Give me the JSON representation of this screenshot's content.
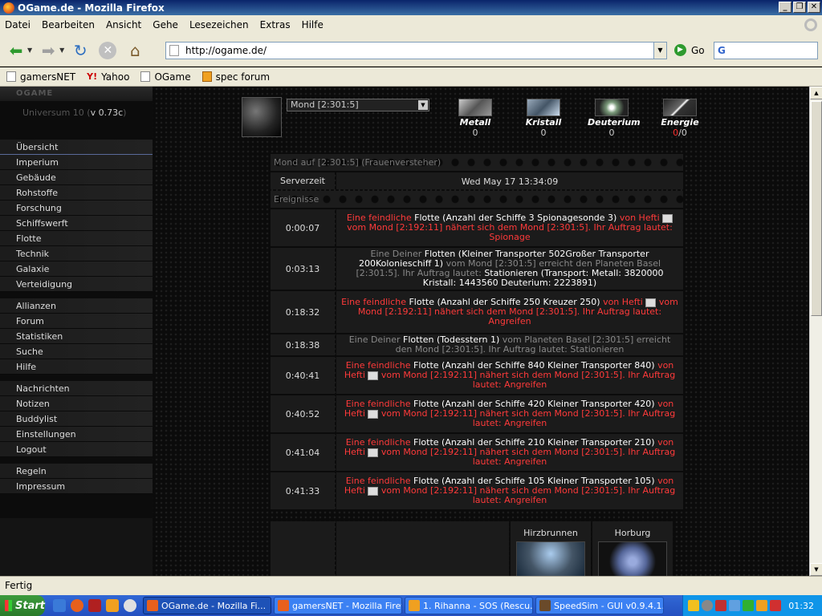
{
  "window": {
    "title": "OGame.de - Mozilla Firefox",
    "buttons": [
      "_",
      "❐",
      "✕"
    ]
  },
  "menubar": [
    "Datei",
    "Bearbeiten",
    "Ansicht",
    "Gehe",
    "Lesezeichen",
    "Extras",
    "Hilfe"
  ],
  "navbar": {
    "url": "http://ogame.de/",
    "go_label": "Go",
    "search_value": "G"
  },
  "bookmarks": [
    {
      "label": "gamersNET",
      "icon": "page-icon"
    },
    {
      "label": "Yahoo",
      "icon": "yahoo-icon"
    },
    {
      "label": "OGame",
      "icon": "page-icon"
    },
    {
      "label": "spec forum",
      "icon": "folder-icon"
    }
  ],
  "game": {
    "logo": "OGAME",
    "universe": "Universum 10",
    "version": "v 0.73c",
    "menu_groups": [
      [
        "Übersicht",
        "Imperium",
        "Gebäude",
        "Rohstoffe",
        "Forschung",
        "Schiffswerft",
        "Flotte",
        "Technik",
        "Galaxie",
        "Verteidigung"
      ],
      [
        "Allianzen",
        "Forum",
        "Statistiken",
        "Suche",
        "Hilfe"
      ],
      [
        "Nachrichten",
        "Notizen",
        "Buddylist",
        "Einstellungen",
        "Logout"
      ],
      [
        "Regeln",
        "Impressum"
      ]
    ],
    "planet_select": "Mond [2:301:5]",
    "resources": [
      {
        "name": "Metall",
        "value": "0",
        "cls": "metal"
      },
      {
        "name": "Kristall",
        "value": "0",
        "cls": "crystal"
      },
      {
        "name": "Deuterium",
        "value": "0",
        "cls": "deut"
      },
      {
        "name": "Energie",
        "value": "0",
        "max": "0",
        "cls": "energy"
      }
    ],
    "overview_title": "Mond auf [2:301:5] (Frauenversteher)",
    "server_time_label": "Serverzeit",
    "server_time": "Wed May 17 13:34:09",
    "events_label": "Ereignisse",
    "events": [
      {
        "time": "0:00:07",
        "type": "hostile",
        "parts": [
          [
            "Eine feindliche ",
            ""
          ],
          [
            "Flotte",
            "w"
          ],
          [
            " (Anzahl der Schiffe 3 Spionagesonde 3) ",
            "w"
          ],
          [
            "von Hefti ",
            ""
          ],
          [
            "[msg]",
            ""
          ],
          [
            " vom Mond [2:192:11] nähert sich dem Mond [2:301:5]. Ihr Auftrag lautet: Spionage",
            ""
          ]
        ]
      },
      {
        "time": "0:03:13",
        "type": "own",
        "parts": [
          [
            "Eine Deiner ",
            ""
          ],
          [
            "Flotten",
            "w"
          ],
          [
            " (Kleiner Transporter 502Großer Transporter 200Kolonieschiff 1) ",
            "w"
          ],
          [
            "vom Mond [2:301:5] erreicht den Planeten Basel [2:301:5]. Ihr Auftrag lautet: ",
            ""
          ],
          [
            "Stationieren",
            "w"
          ],
          [
            " (Transport: Metall: 3820000 Kristall: 1443560 Deuterium: 2223891)",
            "w"
          ]
        ]
      },
      {
        "time": "0:18:32",
        "type": "hostile",
        "parts": [
          [
            "Eine feindliche ",
            ""
          ],
          [
            "Flotte",
            "w"
          ],
          [
            " (Anzahl der Schiffe 250 Kreuzer 250) ",
            "w"
          ],
          [
            "von Hefti ",
            ""
          ],
          [
            "[msg]",
            ""
          ],
          [
            " vom Mond [2:192:11] nähert sich dem Mond [2:301:5]. Ihr Auftrag lautet: Angreifen",
            ""
          ]
        ]
      },
      {
        "time": "0:18:38",
        "type": "own",
        "parts": [
          [
            "Eine Deiner ",
            ""
          ],
          [
            "Flotten",
            "w"
          ],
          [
            " (Todesstern 1) ",
            "w"
          ],
          [
            "vom Planeten Basel [2:301:5] erreicht den Mond [2:301:5]. Ihr Auftrag lautet: Stationieren",
            ""
          ]
        ]
      },
      {
        "time": "0:40:41",
        "type": "hostile",
        "parts": [
          [
            "Eine feindliche ",
            ""
          ],
          [
            "Flotte",
            "w"
          ],
          [
            " (Anzahl der Schiffe 840 Kleiner Transporter 840) ",
            "w"
          ],
          [
            "von Hefti ",
            ""
          ],
          [
            "[msg]",
            ""
          ],
          [
            " vom Mond [2:192:11] nähert sich dem Mond [2:301:5]. Ihr Auftrag lautet: Angreifen",
            ""
          ]
        ]
      },
      {
        "time": "0:40:52",
        "type": "hostile",
        "parts": [
          [
            "Eine feindliche ",
            ""
          ],
          [
            "Flotte",
            "w"
          ],
          [
            " (Anzahl der Schiffe 420 Kleiner Transporter 420) ",
            "w"
          ],
          [
            "von Hefti ",
            ""
          ],
          [
            "[msg]",
            ""
          ],
          [
            " vom Mond [2:192:11] nähert sich dem Mond [2:301:5]. Ihr Auftrag lautet: Angreifen",
            ""
          ]
        ]
      },
      {
        "time": "0:41:04",
        "type": "hostile",
        "parts": [
          [
            "Eine feindliche ",
            ""
          ],
          [
            "Flotte",
            "w"
          ],
          [
            " (Anzahl der Schiffe 210 Kleiner Transporter 210) ",
            "w"
          ],
          [
            "von Hefti ",
            ""
          ],
          [
            "[msg]",
            ""
          ],
          [
            " vom Mond [2:192:11] nähert sich dem Mond [2:301:5]. Ihr Auftrag lautet: Angreifen",
            ""
          ]
        ]
      },
      {
        "time": "0:41:33",
        "type": "hostile",
        "parts": [
          [
            "Eine feindliche ",
            ""
          ],
          [
            "Flotte",
            "w"
          ],
          [
            " (Anzahl der Schiffe 105 Kleiner Transporter 105) ",
            "w"
          ],
          [
            "von Hefti ",
            ""
          ],
          [
            "[msg]",
            ""
          ],
          [
            " vom Mond [2:192:11] nähert sich dem Mond [2:301:5]. Ihr Auftrag lautet: Angreifen",
            ""
          ]
        ]
      }
    ],
    "planets": [
      {
        "name": "Hirzbrunnen",
        "cls": "t1"
      },
      {
        "name": "Horburg",
        "cls": "t2"
      }
    ]
  },
  "statusbar": "Fertig",
  "taskbar": {
    "start": "Start",
    "tasks": [
      {
        "label": "OGame.de - Mozilla Fi...",
        "active": true,
        "color": "#e8601c"
      },
      {
        "label": "gamersNET - Mozilla Firefox",
        "active": false,
        "color": "#e8601c"
      },
      {
        "label": "1. Rihanna - SOS (Rescu...",
        "active": false,
        "color": "#f0a020"
      },
      {
        "label": "SpeedSim - GUI v0.9.4.1...",
        "active": false,
        "color": "#6a4a2a"
      }
    ],
    "clock": "01:32"
  }
}
